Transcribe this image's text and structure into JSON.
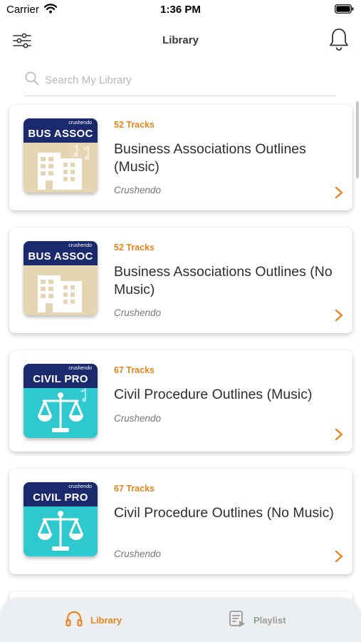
{
  "status_bar": {
    "carrier": "Carrier",
    "time": "1:36 PM"
  },
  "header": {
    "title": "Library",
    "filter_icon": "sliders-icon",
    "bell_icon": "bell-icon"
  },
  "search": {
    "placeholder": "Search My Library",
    "icon": "search-icon"
  },
  "theme": {
    "accent": "#e8841c",
    "cover_band": "#1a2a6c",
    "bus_assoc_art": "#e5d5b2",
    "civil_pro_art": "#2ec9cf",
    "tab_bar_bg": "#eceff1"
  },
  "library": {
    "items": [
      {
        "cover_label": "BUS ASSOC",
        "cover_brand": "crushendo",
        "cover_icon": "building-icon",
        "tracks": "52 Tracks",
        "title": "Business Associations Outlines (Music)",
        "author": "Crushendo"
      },
      {
        "cover_label": "BUS ASSOC",
        "cover_brand": "crushendo",
        "cover_icon": "building-icon",
        "tracks": "52 Tracks",
        "title": "Business Associations Outlines (No Music)",
        "author": "Crushendo"
      },
      {
        "cover_label": "CIVIL PRO",
        "cover_brand": "crushendo",
        "cover_icon": "scales-icon",
        "tracks": "67 Tracks",
        "title": "Civil Procedure Outlines (Music)",
        "author": "Crushendo"
      },
      {
        "cover_label": "CIVIL PRO",
        "cover_brand": "crushendo",
        "cover_icon": "scales-icon",
        "tracks": "67 Tracks",
        "title": "Civil Procedure Outlines (No Music)",
        "author": "Crushendo"
      }
    ]
  },
  "tab_bar": {
    "tabs": [
      {
        "label": "Library",
        "icon": "headphones-icon",
        "active": true
      },
      {
        "label": "Playlist",
        "icon": "playlist-icon",
        "active": false
      }
    ]
  }
}
